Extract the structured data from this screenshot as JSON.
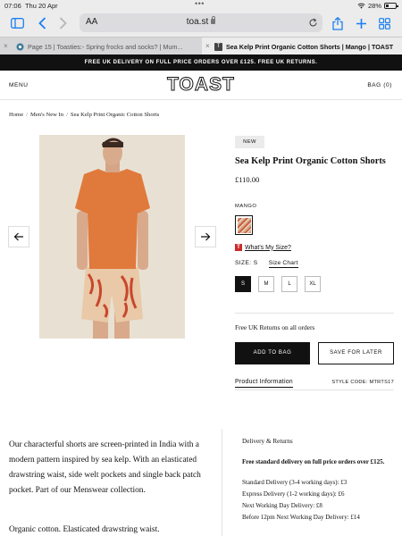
{
  "status": {
    "time": "07:06",
    "date": "Thu 20 Apr",
    "battery": "28%",
    "battery_level": 0.28
  },
  "browser": {
    "text_size": "AA",
    "host": "toa.st",
    "tabs": [
      {
        "title": "Page 15 | Toasties:- Spring frocks and socks? | Mum..."
      },
      {
        "title": "Sea Kelp Print Organic Cotton Shorts | Mango | TOAST",
        "favicon": "T"
      }
    ]
  },
  "promo": "FREE UK DELIVERY ON FULL PRICE ORDERS OVER £125. FREE UK RETURNS.",
  "header": {
    "menu": "MENU",
    "logo": "TOAST",
    "bag": "BAG (0)"
  },
  "breadcrumb": [
    "Home",
    "Men's New In",
    "Sea Kelp Print Organic Cotton Shorts"
  ],
  "breadcrumb_sep": "/",
  "product": {
    "badge": "NEW",
    "title": "Sea Kelp Print Organic Cotton Shorts",
    "price": "£110.00",
    "colour": "MANGO",
    "whats_my_size": "What's My Size?",
    "size_label": "SIZE: S",
    "size_chart": "Size Chart",
    "sizes": [
      "S",
      "M",
      "L",
      "XL"
    ],
    "selected_size": "S",
    "returns_note": "Free UK Returns on all orders",
    "add_to_bag": "ADD TO BAG",
    "save_for_later": "SAVE FOR LATER",
    "product_information": "Product Information",
    "style_code": "STYLE CODE: MTRTS17"
  },
  "description": {
    "para1": "Our characterful shorts are screen-printed in India with a modern pattern inspired by sea kelp. With an elasticated drawstring waist, side welt pockets and single back patch pocket. Part of our Menswear collection.",
    "para2": "Organic cotton. Elasticated drawstring waist."
  },
  "delivery": {
    "heading": "Delivery & Returns",
    "highlight": "Free standard delivery on full price orders over £125.",
    "lines": [
      "Standard Delivery (3-4 working days): £3",
      "Express Delivery (1-2 working days): £6",
      "Next Working Day Delivery: £8",
      "Before 12pm Next Working Day Delivery: £14"
    ]
  },
  "colors": {
    "promo_bg": "#111111",
    "accent_blue": "#1a7ff0",
    "badge_bg": "#ebebeb",
    "t_icon": "#cc2b2b"
  }
}
